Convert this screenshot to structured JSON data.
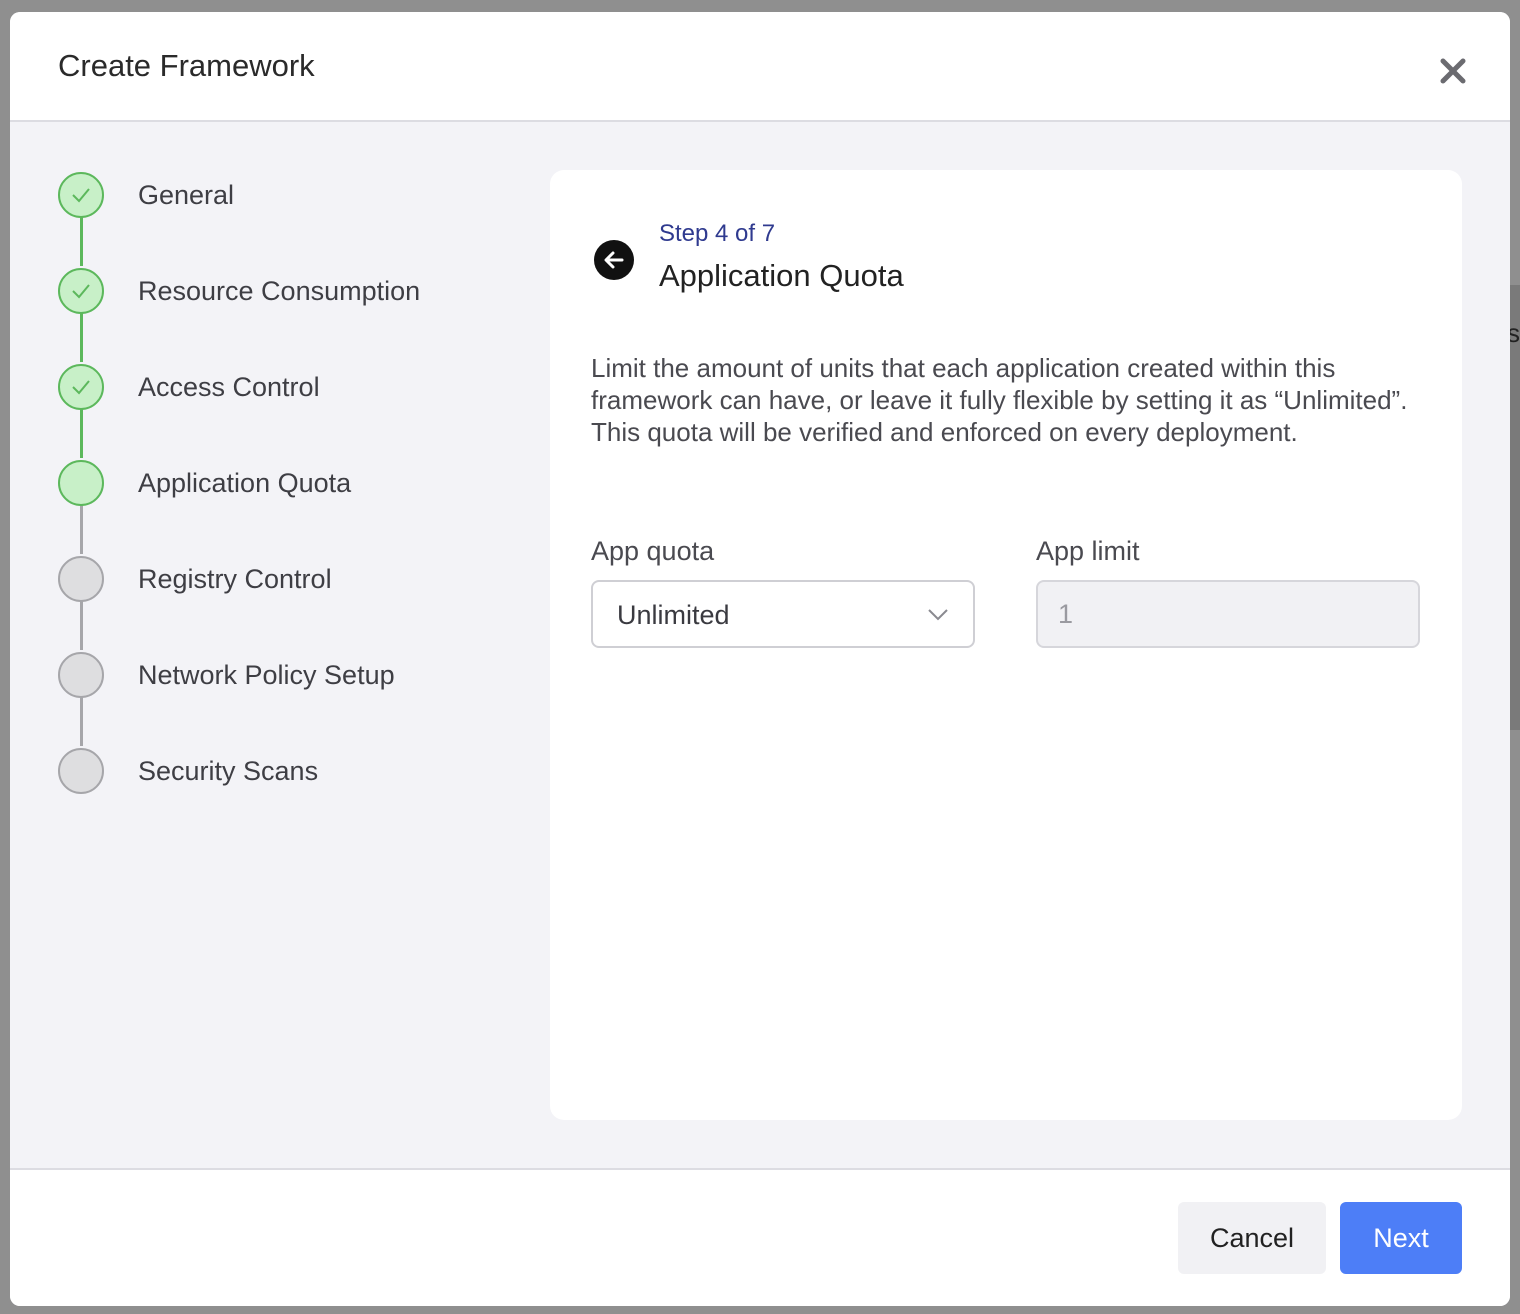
{
  "modal": {
    "title": "Create Framework"
  },
  "stepper": {
    "steps": [
      {
        "label": "General",
        "status": "done"
      },
      {
        "label": "Resource Consumption",
        "status": "done"
      },
      {
        "label": "Access Control",
        "status": "done"
      },
      {
        "label": "Application Quota",
        "status": "current"
      },
      {
        "label": "Registry Control",
        "status": "pending"
      },
      {
        "label": "Network Policy Setup",
        "status": "pending"
      },
      {
        "label": "Security Scans",
        "status": "pending"
      }
    ]
  },
  "content": {
    "step_indicator": "Step 4 of 7",
    "title": "Application Quota",
    "description": "Limit the amount of units that each application created within this framework can have, or leave it fully flexible by setting it as “Unlimited”. This quota will be verified and enforced on every deployment.",
    "app_quota": {
      "label": "App quota",
      "value": "Unlimited"
    },
    "app_limit": {
      "label": "App limit",
      "value": "1",
      "disabled": true
    }
  },
  "footer": {
    "cancel_label": "Cancel",
    "next_label": "Next"
  },
  "colors": {
    "accent": "#4d7ef7",
    "step_done": "#5cb85c",
    "step_done_fill": "#c8f0c8",
    "step_pending": "#a6a6aa",
    "step_indicator": "#2f3a8f"
  },
  "backdrop": {
    "partial_text": "s"
  }
}
